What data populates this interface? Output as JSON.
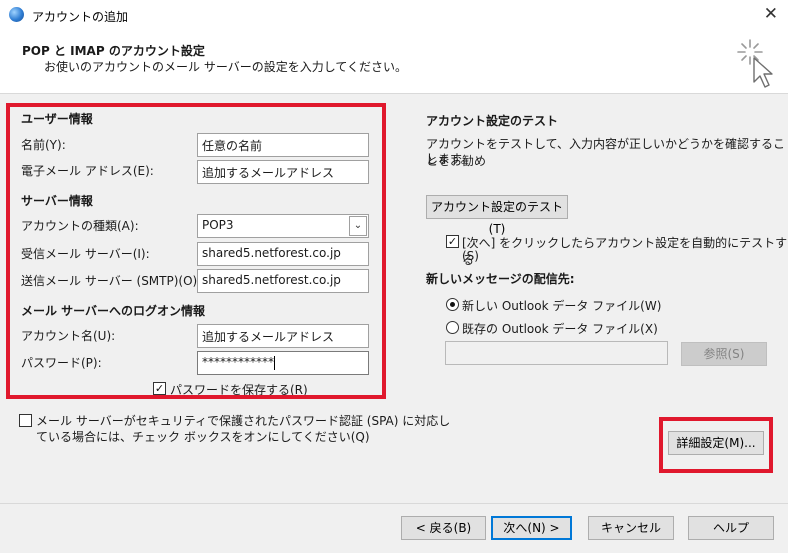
{
  "window": {
    "title": "アカウントの追加",
    "close_glyph": "✕",
    "icon": "outlook-globe-icon"
  },
  "header": {
    "title": "POP と IMAP のアカウント設定",
    "subtitle": "お使いのアカウントのメール サーバーの設定を入力してください。",
    "icon": "cursor-click-icon"
  },
  "user_info": {
    "heading": "ユーザー情報",
    "name_label": "名前(Y):",
    "name_value": "任意の名前",
    "email_label": "電子メール アドレス(E):",
    "email_value": "追加するメールアドレス"
  },
  "server_info": {
    "heading": "サーバー情報",
    "account_type_label": "アカウントの種類(A):",
    "account_type_value": "POP3",
    "incoming_label": "受信メール サーバー(I):",
    "incoming_value": "shared5.netforest.co.jp",
    "outgoing_label": "送信メール サーバー (SMTP)(O):",
    "outgoing_value": "shared5.netforest.co.jp"
  },
  "logon_info": {
    "heading": "メール サーバーへのログオン情報",
    "account_name_label": "アカウント名(U):",
    "account_name_value": "追加するメールアドレス",
    "password_label": "パスワード(P):",
    "password_value": "************",
    "save_password_label": "パスワードを保存する(R)",
    "save_password_checked": true
  },
  "spa": {
    "line1": "メール サーバーがセキュリティで保護されたパスワード認証 (SPA) に対応し",
    "line2": "ている場合には、チェック ボックスをオンにしてください(Q)",
    "checked": false
  },
  "test_panel": {
    "heading": "アカウント設定のテスト",
    "desc_line1": "アカウントをテストして、入力内容が正しいかどうかを確認することをお勧め",
    "desc_line2": "します。",
    "test_button": "アカウント設定のテスト(T)",
    "auto_test_line1": "[次へ] をクリックしたらアカウント設定を自動的にテストする",
    "auto_test_line2": "(S)",
    "auto_test_checked": true
  },
  "delivery": {
    "heading": "新しいメッセージの配信先:",
    "option_new": "新しい Outlook データ ファイル(W)",
    "option_existing": "既存の Outlook データ ファイル(X)",
    "selected": "new",
    "browse_button": "参照(S)",
    "existing_path": ""
  },
  "more_settings_button": "詳細設定(M)...",
  "footer": {
    "back": "< 戻る(B)",
    "next": "次へ(N) >",
    "cancel": "キャンセル",
    "help": "ヘルプ"
  },
  "colors": {
    "highlight_red": "#e0182d",
    "dialog_bg": "#f0f0f0",
    "default_button_border": "#0078d7"
  }
}
